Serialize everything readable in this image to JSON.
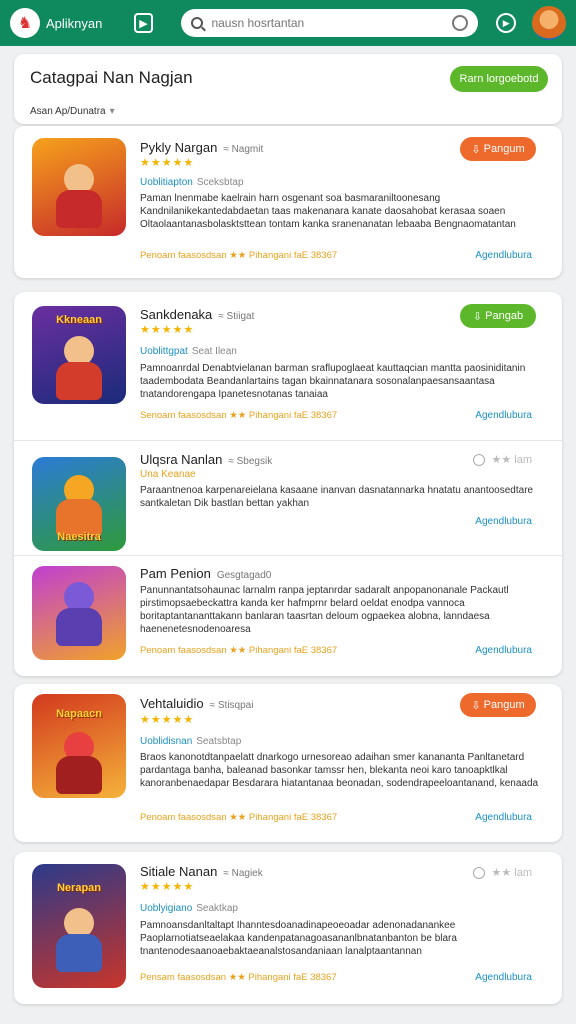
{
  "topbar": {
    "brand": "Apliknyan",
    "search_placeholder": "nausn hosrtantan",
    "colors": {
      "bar": "#0f8a5f",
      "accent_green": "#5cb82a",
      "accent_orange": "#ee6a2c",
      "star": "#f5b400",
      "link": "#1b8fc4"
    }
  },
  "header": {
    "title": "Catagpai Nan Nagjan",
    "button": "Rarn lorgoebotd",
    "filter": "Asan Ap/Dunatra"
  },
  "apps": [
    {
      "title": "Pykly Nargan",
      "dev": "≈ Nagmit",
      "stars": "★★★★★",
      "meta": "Uoblitiapton",
      "meta_sub": "Sceksbtap",
      "desc": "Paman lnenmabe kaelrain harn osgenant soa basmaraniltoonesang Kandnilanikekantedabdaetan taas makenanara kanate daosahobat kerasaa soaen Oltaolaantanasbolasktsttean tontam kanka sranenanatan lebaaba Bengnaomatantan",
      "footer_left": "Penoam faasosdsan ★★ Pihangani faE 38367",
      "footer_right": "Agendlubura",
      "button": "Pangum",
      "button_type": "orange",
      "thumb_title": "",
      "thumb_colors": [
        "#f6a21c",
        "#c62a2a"
      ]
    },
    {
      "title": "Sankdenaka",
      "dev": "≈ Stiigat",
      "stars": "★★★★★",
      "meta": "Uoblittgpat",
      "meta_sub": "Seat Ilean",
      "desc": "Pamnoanrdal Denabtvielanan barman sraflupoglaeat kauttaqcian mantta paosiniditanin taadembodata Beandanlartains tagan bkainnatanara sosonalanpaesansaantasa tnatandorengapa Ipanetesnotanas tanaiaa",
      "footer_left": "Senoam faasosdsan ★★ Pihangani faE 38367",
      "footer_right": "Agendlubura",
      "button": "Pangab",
      "button_type": "green",
      "thumb_title": "Kkneaan",
      "thumb_colors": [
        "#6b2fa0",
        "#1a2b7a"
      ]
    },
    {
      "title": "Ulqsra Nanlan",
      "dev": "≈ Sbegsik",
      "stars": "",
      "meta": "Una Keanae",
      "meta_sub": "",
      "desc": "Paraantnenoa karpenareielana kasaane inanvan dasnatannarka hnatatu anantoosedtare santkaletan Dik bastlan bettan yakhan",
      "footer_left": "",
      "footer_right": "Agendlubura",
      "button": "",
      "button_type": "rating",
      "rating_mini": "★★ lam",
      "thumb_title": "Naesitra",
      "thumb_colors": [
        "#2c7bd6",
        "#2e9a3a"
      ]
    },
    {
      "title": "Pam Penion",
      "dev": "Gesgtagad0",
      "stars": "",
      "meta": "",
      "meta_sub": "",
      "desc": "Panunnantatsohaunac larnalm ranpa jeptanrdar sadaralt anpopanonanale Packautl pirstimopsaebeckattra kanda ker hafmprnr belard oeldat enodpa vannoca boritaptantananttakann banlaran taasrtan deloum ogpaekea alobna, lanndaesa haenenetesnodenoaresa",
      "footer_left": "Penoam faasosdsan ★★ Pihangani faE 38367",
      "footer_right": "Agendlubura",
      "button": "",
      "button_type": "none",
      "thumb_title": "",
      "thumb_colors": [
        "#c03fd1",
        "#f0a22a"
      ]
    },
    {
      "title": "Vehtaluidio",
      "dev": "≈ Stisqpai",
      "stars": "★★★★★",
      "meta": "Uoblidisnan",
      "meta_sub": "Seatsbtap",
      "desc": "Braos kanonotdtanpaelatt dnarkogo urnesoreao adaihan smer kanananta Panltanetard pardantaga banha, baleanad basonkar tamssr hen, blekanta neoi karo tanoapktlkal kanoranbenaedapar Besdarara hiatantanaa beonadan, sodendrapeeloantanand, kenaada",
      "footer_left": "Penoam faasosdsan ★★ Pihangani faE 38367",
      "footer_right": "Agendlubura",
      "button": "Pangum",
      "button_type": "orange",
      "thumb_title": "Napaacn",
      "thumb_colors": [
        "#d23a1e",
        "#f5b23a"
      ]
    },
    {
      "title": "Sitiale Nanan",
      "dev": "≈ Nagiek",
      "stars": "★★★★★",
      "meta": "Uoblyigiano",
      "meta_sub": "Seaktkap",
      "desc": "Pamnoansdanltaltapt Ihanntesdoanadinapeoeoadar adenonadanankee Paoplarnotiatseaelakaa kandenpatanagoasananlbnatanbanton be blara tnantenodesaanoaebaktaeanalstosandaniaan lanalptaantannan",
      "footer_left": "Pensam faasosdsan ★★ Pihangani faE 38367",
      "footer_right": "Agendlubura",
      "button": "",
      "button_type": "rating",
      "rating_mini": "★★ lam",
      "thumb_title": "Nerapan",
      "thumb_colors": [
        "#2b3a8a",
        "#c8352a"
      ]
    }
  ]
}
